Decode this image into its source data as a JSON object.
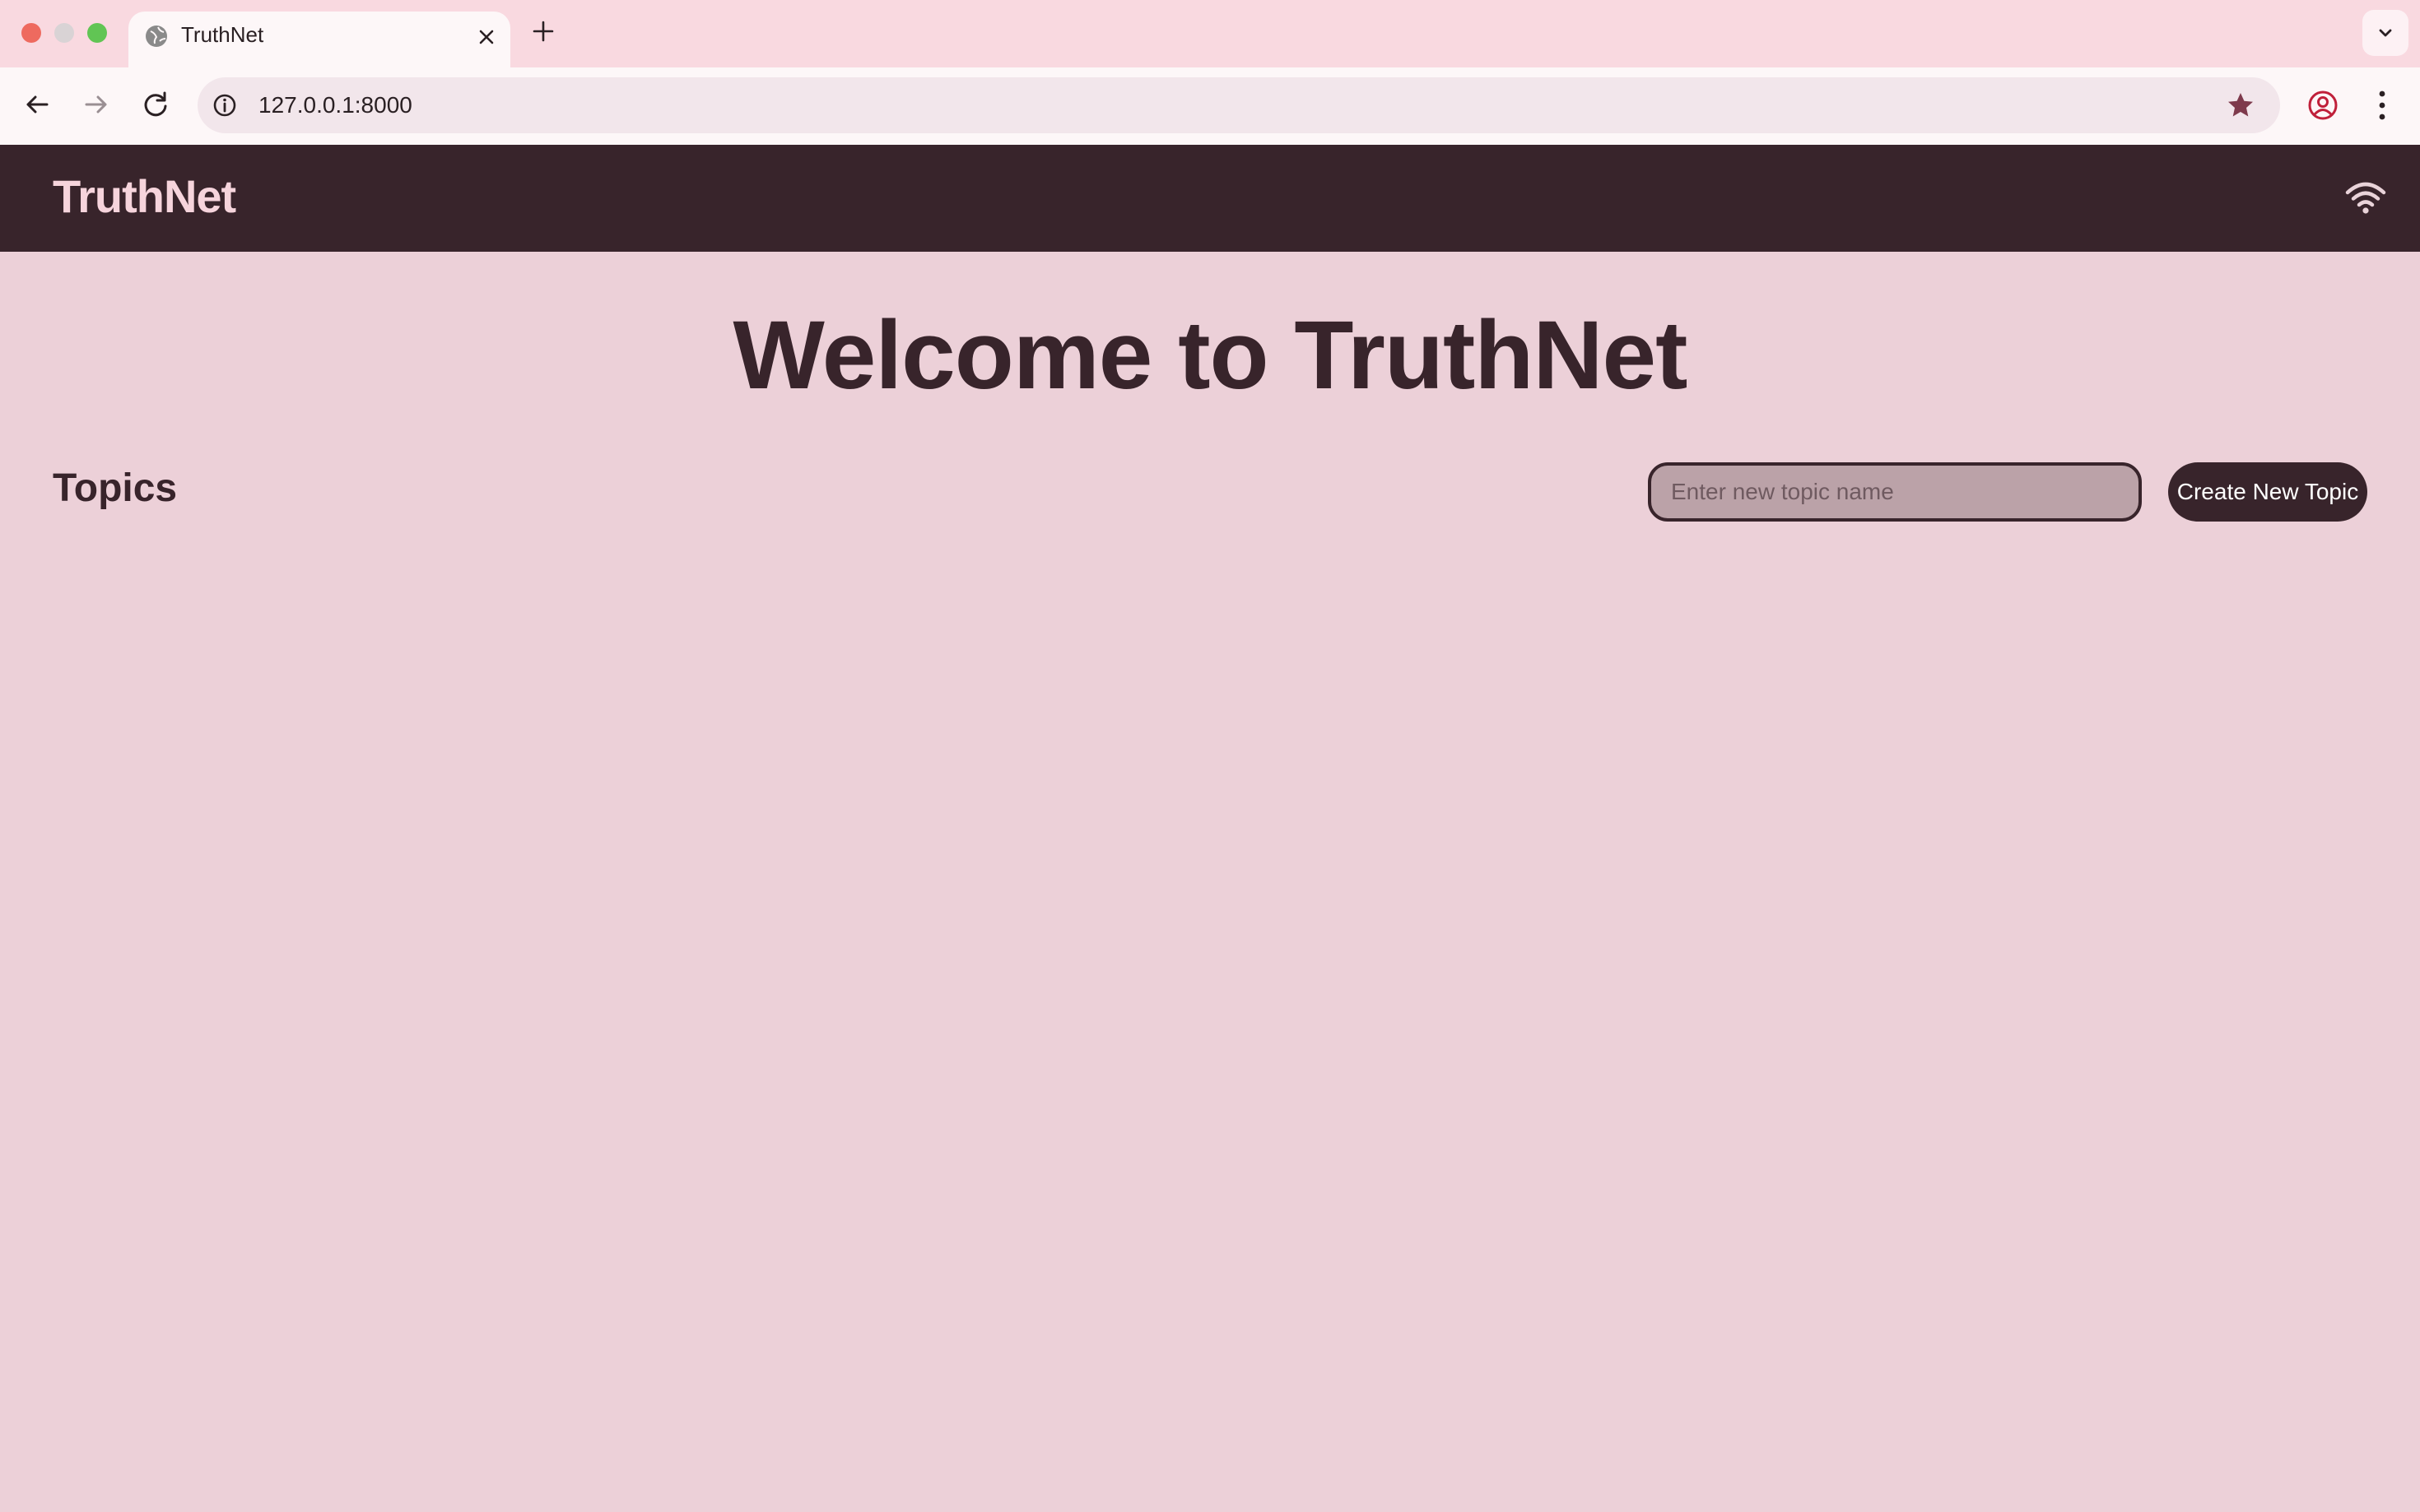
{
  "browser": {
    "tab": {
      "title": "TruthNet",
      "favicon": "globe-icon"
    },
    "address_bar": {
      "url": "127.0.0.1:8000"
    },
    "icons": {
      "back": "arrow-left-icon",
      "forward": "arrow-right-icon",
      "reload": "reload-icon",
      "info": "info-icon",
      "bookmark": "star-icon",
      "profile": "profile-icon",
      "menu": "vertical-dots-icon",
      "new_tab": "plus-icon",
      "close_tab": "close-icon",
      "tab_search": "chevron-down-icon"
    }
  },
  "header": {
    "brand": "TruthNet",
    "status_icon": "wifi-icon"
  },
  "main": {
    "title": "Welcome to TruthNet",
    "topics": {
      "heading": "Topics",
      "input_placeholder": "Enter new topic name",
      "input_value": "",
      "create_button": "Create New Topic"
    }
  },
  "colors": {
    "page_background": "#ecd0d8",
    "header_background": "#38242b",
    "brand_text": "#f6d4dc",
    "primary_text": "#38242b",
    "input_background": "#bba2a8"
  }
}
